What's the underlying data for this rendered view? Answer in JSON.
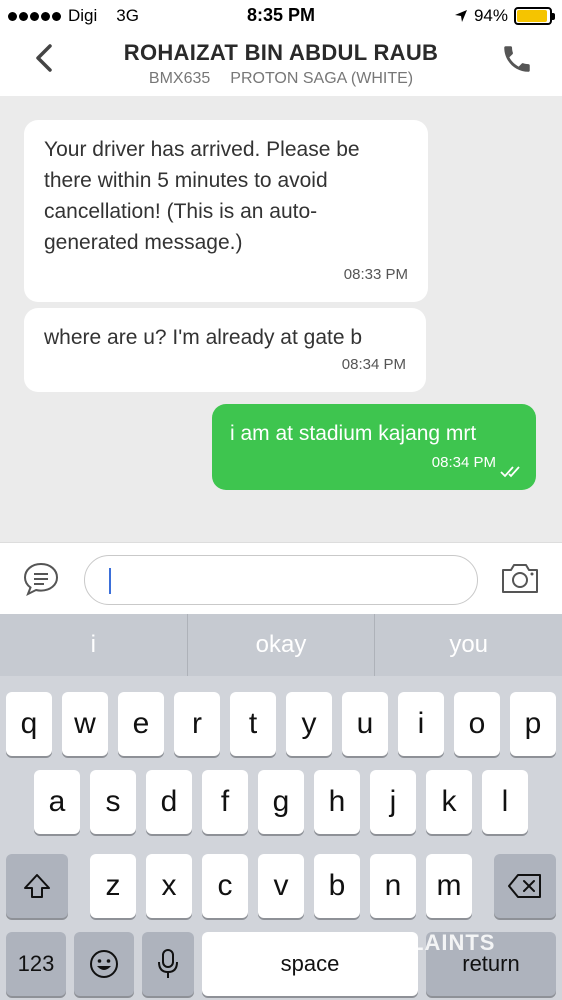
{
  "status_bar": {
    "carrier": "Digi",
    "network": "3G",
    "time": "8:35 PM",
    "battery": "94%",
    "battery_level": 0.94
  },
  "header": {
    "title": "ROHAIZAT BIN ABDUL RAUB",
    "plate": "BMX635",
    "car": "PROTON SAGA (WHITE)"
  },
  "messages": [
    {
      "direction": "incoming",
      "text": "Your driver has arrived. Please be there within 5 minutes to avoid cancellation! (This is an auto-generated message.)",
      "time": "08:33 PM"
    },
    {
      "direction": "incoming",
      "text": "where are u? I'm already at gate b",
      "time": "08:34 PM"
    },
    {
      "direction": "outgoing",
      "text": "i am at stadium kajang mrt",
      "time": "08:34 PM",
      "status": "read"
    }
  ],
  "input": {
    "value": "",
    "placeholder": ""
  },
  "keyboard": {
    "suggestions": [
      "i",
      "okay",
      "you"
    ],
    "row1": [
      "q",
      "w",
      "e",
      "r",
      "t",
      "y",
      "u",
      "i",
      "o",
      "p"
    ],
    "row2": [
      "a",
      "s",
      "d",
      "f",
      "g",
      "h",
      "j",
      "k",
      "l"
    ],
    "row3": [
      "z",
      "x",
      "c",
      "v",
      "b",
      "n",
      "m"
    ],
    "numbers_label": "123",
    "space_label": "space",
    "return_label": "return"
  },
  "watermark": "LAINTS",
  "colors": {
    "accent": "#3ec54f",
    "battery": "#f5c400",
    "caret": "#3b6fd9"
  }
}
